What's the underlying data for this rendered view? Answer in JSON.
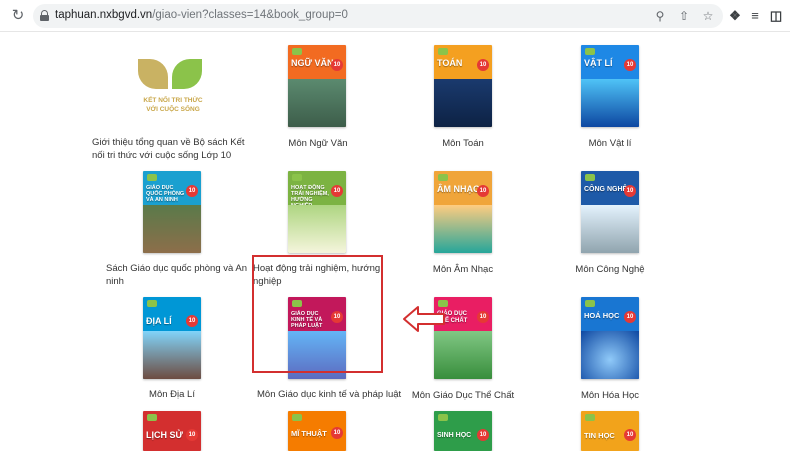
{
  "browser": {
    "url_domain": "taphuan.nxbgvd.vn",
    "url_path": "/giao-vien?classes=14&book_group=0",
    "icons": [
      "reload-icon",
      "lock-icon",
      "zoom-icon",
      "share-icon",
      "star-icon",
      "extensions-icon",
      "media-icon",
      "sidebar-icon"
    ]
  },
  "logo": {
    "line1": "KẾT NỐI TRI THỨC",
    "line2": "VỚI CUỘC SỐNG"
  },
  "books": [
    {
      "caption": "Giới thiệu tổng quan về Bộ sách Kết nối tri thức với cuộc sống Lớp 10",
      "cover_title": "",
      "color": ""
    },
    {
      "caption": "Môn Ngữ Văn",
      "cover_title": "NGỮ VĂN",
      "number": "10",
      "color": "#f26b21"
    },
    {
      "caption": "Môn Toán",
      "cover_title": "TOÁN",
      "number": "10",
      "color": "#f4a020"
    },
    {
      "caption": "Môn Vật lí",
      "cover_title": "VẬT LÍ",
      "number": "10",
      "color": "#1e88e5"
    },
    {
      "caption": "Sách Giáo dục quốc phòng và An ninh",
      "cover_title": "GIÁO DỤC QUỐC PHÒNG VÀ AN NINH",
      "number": "10",
      "color": "#1aa0d0"
    },
    {
      "caption": "Hoạt động trải nghiệm, hướng nghiệp",
      "cover_title": "HOẠT ĐỘNG TRẢI NGHIỆM, HƯỚNG NGHIỆP",
      "number": "10",
      "color": "#7cb342"
    },
    {
      "caption": "Môn Âm Nhạc",
      "cover_title": "ÂM NHẠC",
      "number": "10",
      "color": "#f0a53a"
    },
    {
      "caption": "Môn Công Nghệ",
      "cover_title": "CÔNG NGHỆ",
      "number": "10",
      "color": "#1e5aa8"
    },
    {
      "caption": "Môn Địa Lí",
      "cover_title": "ĐỊA LÍ",
      "number": "10",
      "color": "#0097d6"
    },
    {
      "caption": "Môn Giáo dục kinh tế và pháp luật",
      "cover_title": "GIÁO DỤC KINH TẾ VÀ PHÁP LUẬT",
      "number": "10",
      "color": "#c2185b"
    },
    {
      "caption": "Môn Giáo Dục Thể Chất",
      "cover_title": "GIÁO DỤC THỂ CHẤT",
      "number": "10",
      "color": "#e91e63"
    },
    {
      "caption": "Môn Hóa Học",
      "cover_title": "HOÁ HỌC",
      "number": "10",
      "color": "#1976d2"
    },
    {
      "caption": "",
      "cover_title": "LỊCH SỬ",
      "number": "10",
      "color": "#d32f2f"
    },
    {
      "caption": "",
      "cover_title": "MĨ THUẬT",
      "number": "10",
      "color": "#f57c00"
    },
    {
      "caption": "",
      "cover_title": "SINH HỌC",
      "number": "10",
      "color": "#2e9d4a"
    },
    {
      "caption": "",
      "cover_title": "TIN HỌC",
      "number": "10",
      "color": "#f2a31b"
    }
  ],
  "highlight_color": "#d32f2f"
}
